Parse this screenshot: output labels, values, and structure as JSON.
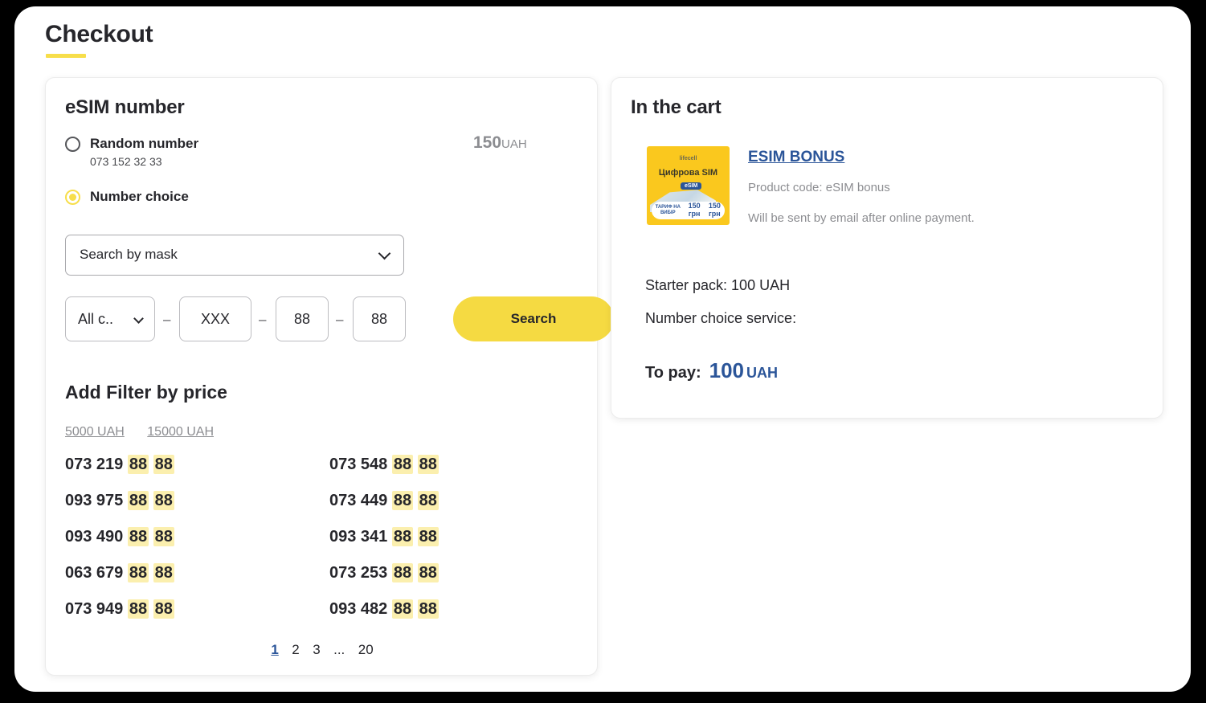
{
  "page": {
    "title": "Checkout"
  },
  "esim_card": {
    "title": "eSIM number",
    "options": [
      {
        "label": "Random number",
        "sub": "073 152 32 33",
        "selected": false
      },
      {
        "label": "Number choice",
        "sub": "",
        "selected": true
      }
    ],
    "random_price": {
      "amount": "150",
      "currency": "UAH"
    },
    "mask_select": {
      "value": "Search by mask",
      "icon": "chevron-down-icon"
    },
    "mask_inputs": {
      "operator": {
        "value": "All c..",
        "icon": "chevron-down-icon"
      },
      "separator": "–",
      "part1": "XXX",
      "part2": "88",
      "part3": "88"
    },
    "search_button": "Search",
    "filter": {
      "title": "Add Filter by price",
      "links": [
        "5000 UAH",
        "15000 UAH"
      ]
    },
    "numbers": {
      "left": [
        {
          "prefix": "073 219",
          "hl1": "88",
          "hl2": "88"
        },
        {
          "prefix": "093 975",
          "hl1": "88",
          "hl2": "88"
        },
        {
          "prefix": "093 490",
          "hl1": "88",
          "hl2": "88"
        },
        {
          "prefix": "063 679",
          "hl1": "88",
          "hl2": "88"
        },
        {
          "prefix": "073 949",
          "hl1": "88",
          "hl2": "88"
        }
      ],
      "right": [
        {
          "prefix": "073 548",
          "hl1": "88",
          "hl2": "88"
        },
        {
          "prefix": "073 449",
          "hl1": "88",
          "hl2": "88"
        },
        {
          "prefix": "093 341",
          "hl1": "88",
          "hl2": "88"
        },
        {
          "prefix": "073 253",
          "hl1": "88",
          "hl2": "88"
        },
        {
          "prefix": "093 482",
          "hl1": "88",
          "hl2": "88"
        }
      ]
    },
    "pagination": {
      "pages": [
        "1",
        "2",
        "3"
      ],
      "ellipsis": "...",
      "last": "20",
      "active": "1"
    }
  },
  "cart_card": {
    "title": "In the cart",
    "thumbnail": {
      "logo": "lifecell",
      "title": "Цифрова SIM",
      "badge": "eSIM",
      "bar": [
        "ТАРИФ НА ВИБІР",
        "150 грн",
        "150 грн"
      ]
    },
    "item": {
      "name": "ESIM BONUS",
      "code": "Product code: eSIM bonus",
      "note": "Will be sent by email after online payment."
    },
    "lines": [
      "Starter pack:  100 UAH",
      "Number choice service:"
    ],
    "to_pay": {
      "label": "To pay:",
      "amount": "100",
      "currency": "UAH"
    }
  },
  "colors": {
    "accent_yellow": "#F5DA42",
    "highlight_yellow": "#FBEFAE",
    "link_blue": "#2B5599",
    "text_dark": "#26262b",
    "text_muted": "#8c8d91"
  }
}
